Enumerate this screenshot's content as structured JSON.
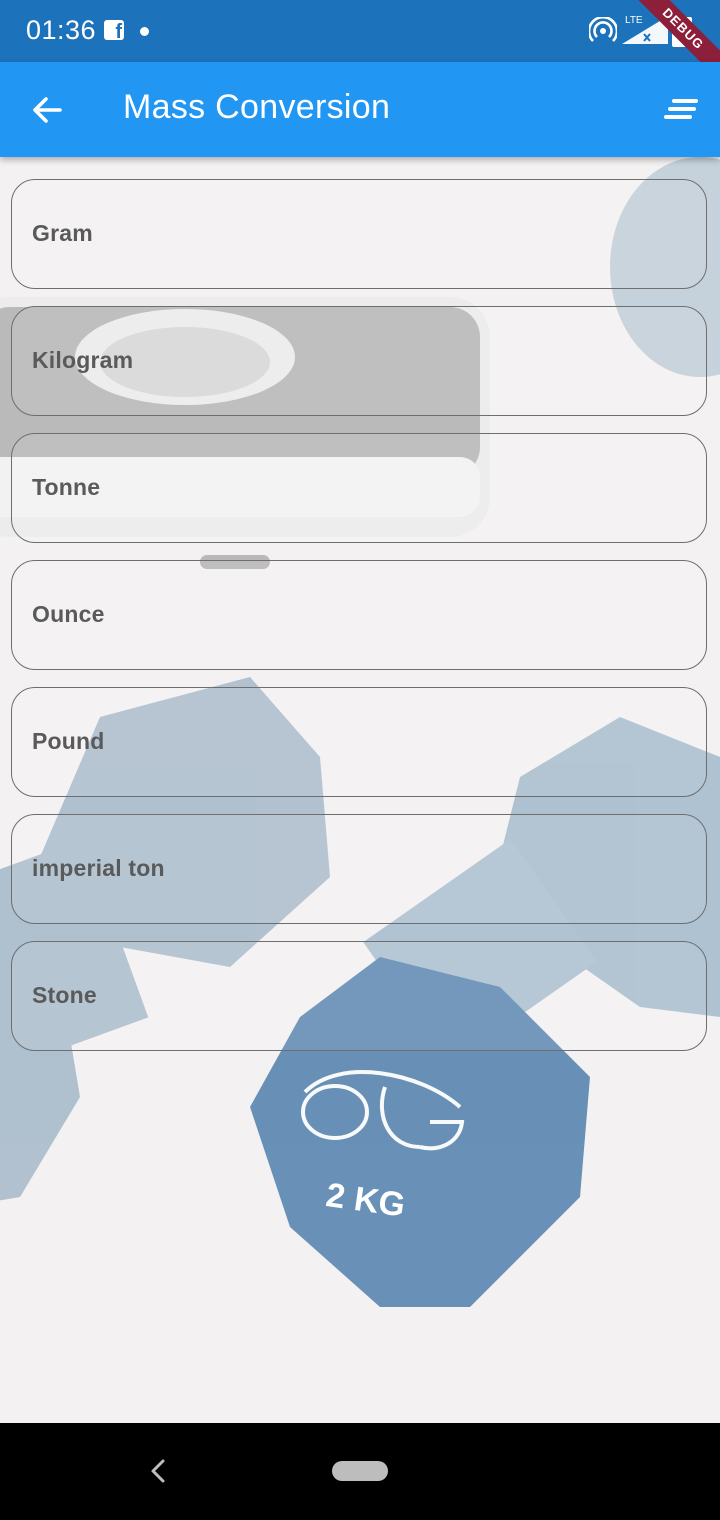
{
  "status_bar": {
    "time": "01:36",
    "network_label": "LTE",
    "battery": "97",
    "debug_banner": "DEBUG"
  },
  "app_bar": {
    "title": "Mass Conversion",
    "back_icon": "arrow-back-icon",
    "menu_icon": "sort-icon"
  },
  "units": [
    {
      "label": "Gram"
    },
    {
      "label": "Kilogram"
    },
    {
      "label": "Tonne"
    },
    {
      "label": "Ounce"
    },
    {
      "label": "Pound"
    },
    {
      "label": "imperial ton"
    },
    {
      "label": "Stone"
    }
  ],
  "background": {
    "dumbbell_brand": "OTG",
    "dumbbell_weight": "2 KG"
  },
  "colors": {
    "status_bar": "#1c72bb",
    "app_bar": "#2196f3",
    "card_border": "#6e6e6e",
    "card_text": "#5a5a5a"
  }
}
